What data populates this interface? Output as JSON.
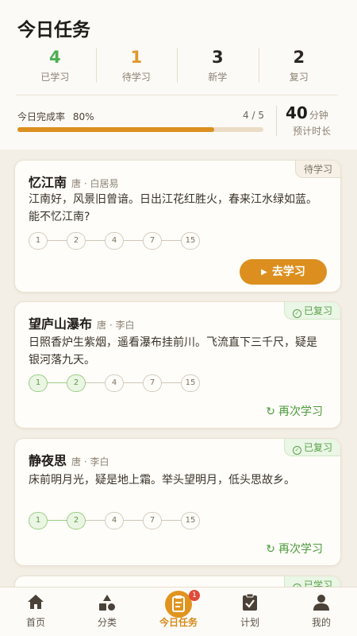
{
  "header": {
    "title": "今日任务",
    "stats": [
      {
        "value": "4",
        "label": "已学习",
        "color": "#4caf50"
      },
      {
        "value": "1",
        "label": "待学习",
        "color": "#e0982a"
      },
      {
        "value": "3",
        "label": "新学",
        "color": "#2b2620"
      },
      {
        "value": "2",
        "label": "复习",
        "color": "#2b2620"
      }
    ],
    "progress": {
      "label": "今日完成率",
      "percent_text": "80%",
      "percent": 0.8,
      "count": "4 / 5"
    },
    "estimate": {
      "value": "40",
      "unit": "分钟",
      "label": "预计时长"
    }
  },
  "cards": [
    {
      "title": "忆江南",
      "author": "唐 · 白居易",
      "text": "江南好，风景旧曾谙。日出江花红胜火，春来江水绿如蓝。能不忆江南?",
      "status": "待学习",
      "status_type": "pending",
      "steps": [
        "1",
        "2",
        "4",
        "7",
        "15"
      ],
      "steps_done": 0,
      "action": "去学习"
    },
    {
      "title": "望庐山瀑布",
      "author": "唐 · 李白",
      "text": "日照香炉生紫烟，遥看瀑布挂前川。飞流直下三千尺，疑是银河落九天。",
      "status": "已复习",
      "status_type": "done",
      "steps": [
        "1",
        "2",
        "4",
        "7",
        "15"
      ],
      "steps_done": 2,
      "action": "再次学习"
    },
    {
      "title": "静夜思",
      "author": "唐 · 李白",
      "text": "床前明月光，疑是地上霜。举头望明月，低头思故乡。",
      "status": "已复习",
      "status_type": "done",
      "steps": [
        "1",
        "2",
        "4",
        "7",
        "15"
      ],
      "steps_done": 2,
      "action": "再次学习"
    },
    {
      "status": "已学习",
      "status_type": "done"
    }
  ],
  "tabbar": {
    "items": [
      {
        "label": "首页",
        "icon": "home-icon"
      },
      {
        "label": "分类",
        "icon": "category-icon"
      },
      {
        "label": "今日任务",
        "icon": "task-icon",
        "active": true,
        "badge": "1"
      },
      {
        "label": "计划",
        "icon": "plan-icon"
      },
      {
        "label": "我的",
        "icon": "user-icon"
      }
    ]
  },
  "colors": {
    "accent": "#dc8f1f",
    "success": "#5aa148"
  }
}
